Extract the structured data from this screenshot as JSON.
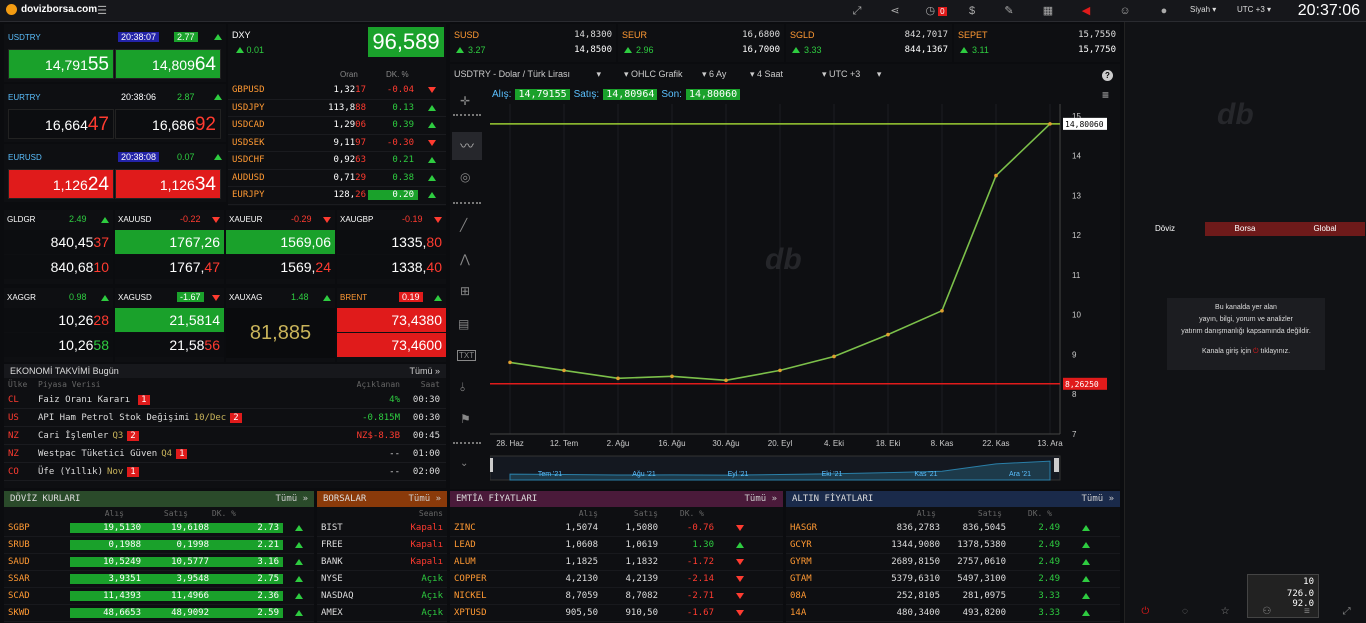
{
  "topbar": {
    "site": "dovizborsa.com",
    "theme": "Siyah",
    "utc": "UTC +3",
    "alarm_count": "0",
    "clock": "20:37:06"
  },
  "fx_tiles": [
    {
      "sym": "USDTRY",
      "time": "20:38:07",
      "chg": "2.77",
      "bid_a": "14,791",
      "bid_b": "55",
      "ask_a": "14,809",
      "ask_b": "64",
      "style": "green"
    },
    {
      "sym": "EURTRY",
      "time": "20:38:06",
      "chg": "2.87",
      "bid_a": "16,664",
      "bid_b": "47",
      "ask_a": "16,686",
      "ask_b": "92",
      "style": "black"
    },
    {
      "sym": "EURUSD",
      "time": "20:38:08",
      "chg": "0.07",
      "bid_a": "1,126",
      "bid_b": "24",
      "ask_a": "1,126",
      "ask_b": "34",
      "style": "red"
    }
  ],
  "dxy": {
    "sym": "DXY",
    "chg": "0.01",
    "value": "96,589",
    "col_rate": "Oran",
    "col_pct": "DK. %"
  },
  "pairs": [
    {
      "sym": "GBPUSD",
      "a": "1,32",
      "b": "17",
      "pct": "-0.04",
      "up": false
    },
    {
      "sym": "USDJPY",
      "a": "113,8",
      "b": "88",
      "pct": "0.13",
      "up": true
    },
    {
      "sym": "USDCAD",
      "a": "1,29",
      "b": "06",
      "pct": "0.39",
      "up": true
    },
    {
      "sym": "USDSEK",
      "a": "9,11",
      "b": "97",
      "pct": "-0.30",
      "up": false
    },
    {
      "sym": "USDCHF",
      "a": "0,92",
      "b": "63",
      "pct": "0.21",
      "up": true
    },
    {
      "sym": "AUDUSD",
      "a": "0,71",
      "b": "29",
      "pct": "0.38",
      "up": true
    },
    {
      "sym": "EURJPY",
      "a": "128,",
      "b": "26",
      "pct": "0.20",
      "up": true
    }
  ],
  "metals": [
    {
      "sym": "GLDGR",
      "chg": "2.49",
      "up": true,
      "r1a": "840,45",
      "r1b": "37",
      "r2a": "840,68",
      "r2b": "10",
      "s1": "black",
      "s2": "black"
    },
    {
      "sym": "XAUUSD",
      "chg": "-0.22",
      "up": false,
      "r1a": "1767,26",
      "r1b": "",
      "r2a": "1767,",
      "r2b": "47",
      "s1": "green",
      "s2": "black"
    },
    {
      "sym": "XAUEUR",
      "chg": "-0.29",
      "up": false,
      "r1a": "1569,06",
      "r1b": "",
      "r2a": "1569,",
      "r2b": "24",
      "s1": "green",
      "s2": "black"
    },
    {
      "sym": "XAUGBP",
      "chg": "-0.19",
      "up": false,
      "r1a": "1335,",
      "r1b": "80",
      "r2a": "1338,",
      "r2b": "40",
      "s1": "black",
      "s2": "black"
    },
    {
      "sym": "XAGGR",
      "chg": "0.98",
      "up": true,
      "r1a": "10,26",
      "r1b": "28",
      "r2a": "10,26",
      "r2b": "58",
      "s1": "black",
      "s2": "black"
    },
    {
      "sym": "XAGUSD",
      "chg": "-1.67",
      "up": false,
      "r1a": "21,5814",
      "r1b": "",
      "r2a": "21,58",
      "r2b": "56",
      "s1": "green",
      "s2": "black"
    },
    {
      "sym": "XAUXAG",
      "chg": "1.48",
      "up": true,
      "single": "81,885"
    },
    {
      "sym": "BRENT",
      "chg": "0.19",
      "up": true,
      "r1a": "73,4380",
      "r1b": "",
      "r2a": "73,4600",
      "r2b": "",
      "s1": "red",
      "s2": "red"
    }
  ],
  "calendar": {
    "title": "EKONOMİ TAKVİMİ Bugün",
    "more": "Tümü »",
    "h_country": "Ülke",
    "h_data": "Piyasa Verisi",
    "h_announced": "Açıklanan",
    "h_time": "Saat",
    "rows": [
      {
        "c": "CL",
        "name": "Faiz Oranı Kararı",
        "extra": "",
        "badge": "1",
        "val": "4%",
        "time": "00:30",
        "valcolor": "up"
      },
      {
        "c": "US",
        "name": "API Ham Petrol Stok Değişimi",
        "extra": "10/Dec",
        "badge": "2",
        "val": "-0.815M",
        "time": "00:30",
        "valcolor": "up"
      },
      {
        "c": "NZ",
        "name": "Cari İşlemler",
        "extra": "Q3",
        "badge": "2",
        "val": "NZ$-8.3B",
        "time": "00:45",
        "valcolor": "dn"
      },
      {
        "c": "NZ",
        "name": "Westpac Tüketici Güven",
        "extra": "Q4",
        "badge": "1",
        "val": "--",
        "time": "01:00",
        "valcolor": "n"
      },
      {
        "c": "CO",
        "name": "Üfe (Yıllık)",
        "extra": "Nov",
        "badge": "1",
        "val": "--",
        "time": "02:00",
        "valcolor": "n"
      }
    ]
  },
  "strip": [
    {
      "sym": "SUSD",
      "chg": "3.27",
      "bid": "14,8300",
      "ask": "14,8500"
    },
    {
      "sym": "SEUR",
      "chg": "2.96",
      "bid": "16,6800",
      "ask": "16,7000"
    },
    {
      "sym": "SGLD",
      "chg": "3.33",
      "bid": "842,7017",
      "ask": "844,1367"
    },
    {
      "sym": "SEPET",
      "chg": "3.11",
      "bid": "15,7550",
      "ask": "15,7750"
    }
  ],
  "chart_controls": {
    "pair": "USDTRY - Dolar / Türk Lirası",
    "type": "OHLC Grafik",
    "period": "6 Ay",
    "interval": "4 Saat",
    "tz": "UTC +3",
    "bid_label": "Alış:",
    "bid": "14,79155",
    "ask_label": "Satış:",
    "ask": "14,80964",
    "last_label": "Son:",
    "last": "14,80060"
  },
  "chart_data": {
    "type": "line",
    "title": "USDTRY - Dolar / Türk Lirası",
    "x": [
      "28. Haz",
      "12. Tem",
      "2. Ağu",
      "16. Ağu",
      "30. Ağu",
      "20. Eyl",
      "4. Eki",
      "18. Eki",
      "8. Kas",
      "22. Kas",
      "13. Ara"
    ],
    "series": [
      {
        "values": [
          8.8,
          8.6,
          8.4,
          8.45,
          8.35,
          8.6,
          8.95,
          9.5,
          10.1,
          13.5,
          14.8
        ]
      }
    ],
    "yticks": [
      "7",
      "8",
      "9",
      "10",
      "11",
      "12",
      "13",
      "14",
      "15"
    ],
    "ylim": [
      7,
      15.3
    ],
    "hline_high": "14,80060",
    "hline_low": "8,26250",
    "nav_labels": [
      "Tem '21",
      "Ağu '21",
      "Eyl '21",
      "Eki '21",
      "Kas '21",
      "Ara '21"
    ]
  },
  "doviz": {
    "title": "DÖVİZ KURLARI",
    "more": "Tümü »",
    "h_bid": "Alış",
    "h_ask": "Satış",
    "h_pct": "DK. %",
    "rows": [
      {
        "s": "SGBP",
        "b": "19,5130",
        "a": "19,6108",
        "p": "2.73"
      },
      {
        "s": "SRUB",
        "b": "0,1988",
        "a": "0,1998",
        "p": "2.21"
      },
      {
        "s": "SAUD",
        "b": "10,5249",
        "a": "10,5777",
        "p": "3.16"
      },
      {
        "s": "SSAR",
        "b": "3,9351",
        "a": "3,9548",
        "p": "2.75"
      },
      {
        "s": "SCAD",
        "b": "11,4393",
        "a": "11,4966",
        "p": "2.36"
      },
      {
        "s": "SKWD",
        "b": "48,6653",
        "a": "48,9092",
        "p": "2.59"
      }
    ]
  },
  "borsa": {
    "title": "BORSALAR",
    "more": "Tümü »",
    "h_session": "Seans",
    "rows": [
      {
        "s": "BIST",
        "st": "Kapalı",
        "open": false
      },
      {
        "s": "FREE",
        "st": "Kapalı",
        "open": false
      },
      {
        "s": "BANK",
        "st": "Kapalı",
        "open": false
      },
      {
        "s": "NYSE",
        "st": "Açık",
        "open": true
      },
      {
        "s": "NASDAQ",
        "st": "Açık",
        "open": true
      },
      {
        "s": "AMEX",
        "st": "Açık",
        "open": true
      }
    ]
  },
  "emtia": {
    "title": "EMTİA FİYATLARI",
    "more": "Tümü »",
    "h_bid": "Alış",
    "h_ask": "Satış",
    "h_pct": "DK. %",
    "rows": [
      {
        "s": "ZINC",
        "b": "1,5074",
        "a": "1,5080",
        "p": "-0.76",
        "up": false
      },
      {
        "s": "LEAD",
        "b": "1,0608",
        "a": "1,0619",
        "p": "1.30",
        "up": true
      },
      {
        "s": "ALUM",
        "b": "1,1825",
        "a": "1,1832",
        "p": "-1.72",
        "up": false
      },
      {
        "s": "COPPER",
        "b": "4,2130",
        "a": "4,2139",
        "p": "-2.14",
        "up": false
      },
      {
        "s": "NICKEL",
        "b": "8,7059",
        "a": "8,7082",
        "p": "-2.71",
        "up": false
      },
      {
        "s": "XPTUSD",
        "b": "905,50",
        "a": "910,50",
        "p": "-1.67",
        "up": false
      }
    ]
  },
  "altin": {
    "title": "ALTIN FİYATLARI",
    "more": "Tümü »",
    "h_bid": "Alış",
    "h_ask": "Satış",
    "h_pct": "DK. %",
    "rows": [
      {
        "s": "HASGR",
        "b": "836,2783",
        "a": "836,5045",
        "p": "2.49"
      },
      {
        "s": "GCYR",
        "b": "1344,9080",
        "a": "1378,5380",
        "p": "2.49"
      },
      {
        "s": "GYRM",
        "b": "2689,8150",
        "a": "2757,0610",
        "p": "2.49"
      },
      {
        "s": "GTAM",
        "b": "5379,6310",
        "a": "5497,3100",
        "p": "2.49"
      },
      {
        "s": "08A",
        "b": "252,8105",
        "a": "281,0975",
        "p": "3.33"
      },
      {
        "s": "14A",
        "b": "480,3400",
        "a": "493,8200",
        "p": "3.33"
      }
    ]
  },
  "right": {
    "tab_doviz": "Döviz",
    "tab_borsa": "Borsa",
    "tab_global": "Global",
    "notice_1": "Bu kanalda yer alan",
    "notice_2": "yayın, bilgi, yorum ve analizler",
    "notice_3": "yatırım danışmanlığı kapsamında değildir.",
    "notice_4": "Kanala giriş için",
    "notice_5": "tıklayınız.",
    "logo": "db"
  },
  "widget": {
    "v1": "10",
    "v2": "726.0",
    "v3": "92.0"
  },
  "colors": {
    "green": "#1aa12b",
    "red": "#e01b1b",
    "accent": "#5bc0ff"
  }
}
